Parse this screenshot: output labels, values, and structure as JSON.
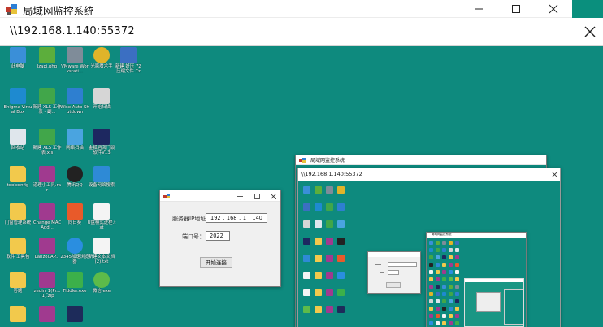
{
  "window": {
    "title": "局域网监控系统"
  },
  "address": {
    "text": "\\\\192.168.1.140:55372"
  },
  "desktop_icons": [
    {
      "label": "此电脑",
      "icon": "pc-icon",
      "color": "#3a8fd8"
    },
    {
      "label": "lzapi.php",
      "icon": "script-icon",
      "color": "#5cae3c"
    },
    {
      "label": "VMware Workstati...",
      "icon": "vmware-icon",
      "color": "#7f8c99"
    },
    {
      "label": "光影魔术手",
      "icon": "camera-lens-icon",
      "color": "#e0b42a"
    },
    {
      "label": "新建 好压 7Z 压缩文件.7z",
      "icon": "archive-icon",
      "color": "#3b6fc2"
    },
    {
      "label": "Enigma Virtual Box",
      "icon": "enigma-icon",
      "color": "#1e8ad0"
    },
    {
      "label": "新建 XLS 工作表 - 副...",
      "icon": "xls-icon",
      "color": "#41a64a"
    },
    {
      "label": "Wise Auto Shutdown",
      "icon": "shutdown-icon",
      "color": "#2e7fd0"
    },
    {
      "label": "开始扫描",
      "icon": "camera-icon",
      "color": "#d6d6d6"
    },
    {
      "label": "回收站",
      "icon": "recycle-bin-icon",
      "color": "#dfe6ec"
    },
    {
      "label": "新建 XLS 工作表.xls",
      "icon": "xls-icon",
      "color": "#41a64a"
    },
    {
      "label": "网络扫描",
      "icon": "network-scan-icon",
      "color": "#4aa4e0"
    },
    {
      "label": "金狐酒店门锁软件V13",
      "icon": "hotel-lock-icon",
      "color": "#1d2860"
    },
    {
      "label": "toolconfig",
      "icon": "folder-icon",
      "color": "#f2c94c"
    },
    {
      "label": "道理小工具.rar",
      "icon": "archive-icon",
      "color": "#a03a8f"
    },
    {
      "label": "腾讯QQ",
      "icon": "qq-icon",
      "color": "#222222"
    },
    {
      "label": "设备网络搜索",
      "icon": "device-search-icon",
      "color": "#2e8ad6"
    },
    {
      "label": "门窗管理系统",
      "icon": "folder-icon",
      "color": "#f2c94c"
    },
    {
      "label": "Change MAC Add...",
      "icon": "archive-icon",
      "color": "#a03a8f"
    },
    {
      "label": "向日葵",
      "icon": "sunflower-icon",
      "color": "#e85a2a"
    },
    {
      "label": "U盘模式进程.txt",
      "icon": "text-file-icon",
      "color": "#f4f4f4"
    },
    {
      "label": "软件 工具包",
      "icon": "folder-icon",
      "color": "#f2c94c"
    },
    {
      "label": "LanzouAP...",
      "icon": "archive-icon",
      "color": "#a03a8f"
    },
    {
      "label": "2345加速浏览器",
      "icon": "browser-icon",
      "color": "#2a8ee0"
    },
    {
      "label": "新建文本文档 (2).txt",
      "icon": "text-file-icon",
      "color": "#f4f4f4"
    },
    {
      "label": "答题",
      "icon": "folder-icon",
      "color": "#f2c94c"
    },
    {
      "label": "zeqin_1(Pr... (1).zip",
      "icon": "archive-icon",
      "color": "#a03a8f"
    },
    {
      "label": "Fiddler.exe",
      "icon": "fiddler-icon",
      "color": "#3cb04a"
    },
    {
      "label": "微信.exe",
      "icon": "wechat-icon",
      "color": "#5dbb4a"
    },
    {
      "label": "",
      "icon": "folder-icon",
      "color": "#f2c94c"
    },
    {
      "label": "",
      "icon": "archive-icon",
      "color": "#a03a8f"
    },
    {
      "label": "",
      "icon": "photoshop-icon",
      "color": "#1d2b5a"
    }
  ],
  "dialog": {
    "server_label": "服务器IP地址：",
    "ip": [
      "192",
      "168",
      "1",
      "140"
    ],
    "port_label": "端口号：",
    "port_value": "2022",
    "start_button": "开始连接"
  },
  "nested": {
    "title": "局域网监控系统",
    "address": "\\\\192.168.1.140:55372",
    "inner_title": "局域网监控系统"
  }
}
